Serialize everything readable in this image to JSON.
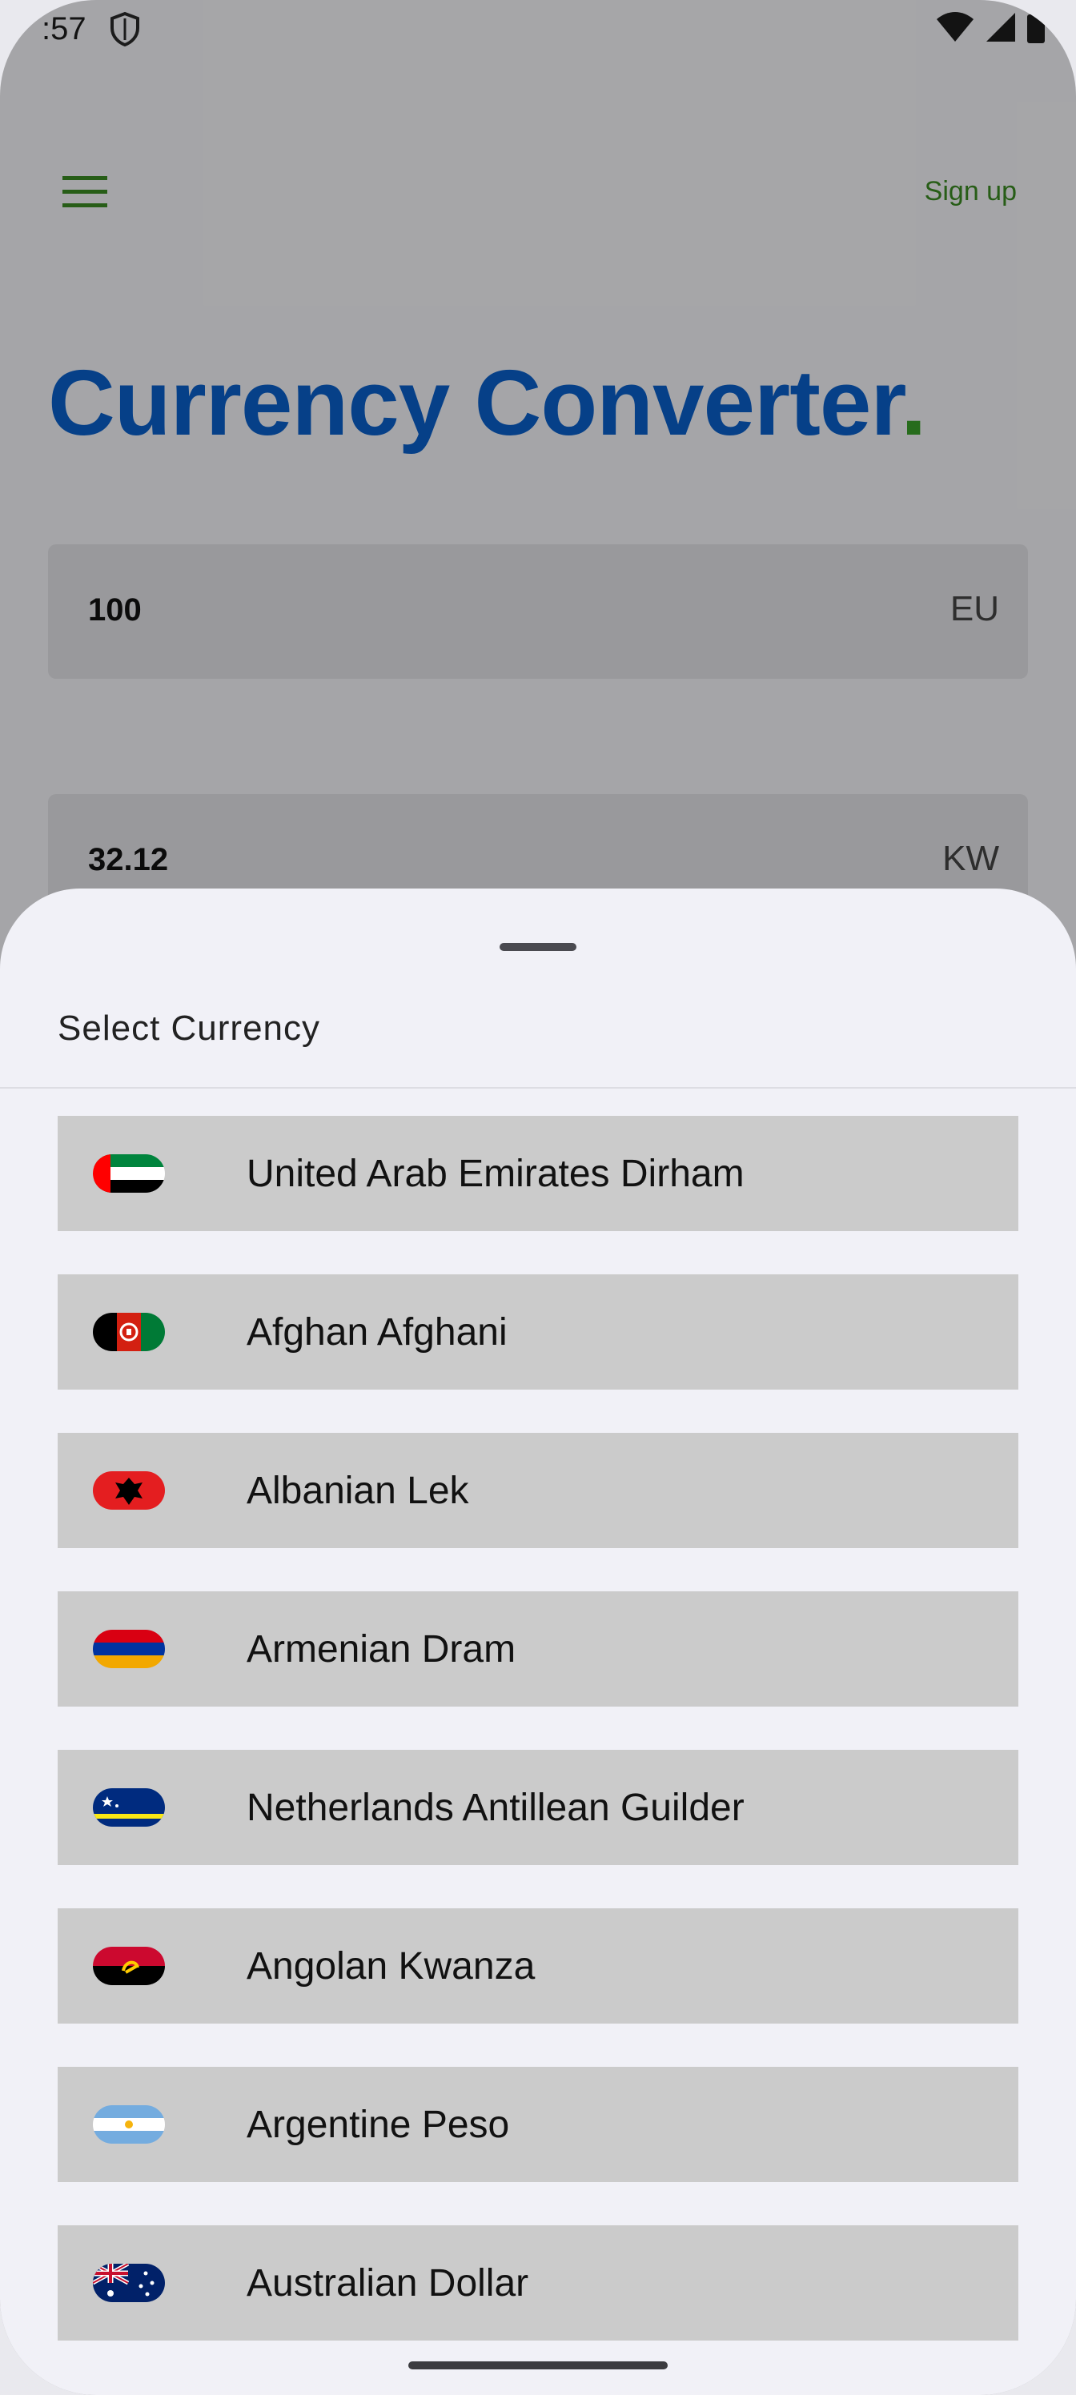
{
  "status_bar": {
    "time": ":57",
    "icons": [
      "shield-icon",
      "wifi-icon",
      "signal-icon",
      "battery-icon"
    ]
  },
  "header": {
    "menu_icon": "hamburger-menu-icon",
    "signup_label": "Sign up"
  },
  "page": {
    "title": "Currency Converter",
    "title_dot": "."
  },
  "converter": {
    "from": {
      "amount": "100",
      "currency": "EU"
    },
    "to": {
      "amount": "32.12",
      "currency": "KW"
    }
  },
  "sheet": {
    "title": "Select Currency",
    "currencies": [
      {
        "name": "United Arab Emirates Dirham",
        "flag": "ae-flag-icon"
      },
      {
        "name": "Afghan Afghani",
        "flag": "af-flag-icon"
      },
      {
        "name": "Albanian Lek",
        "flag": "al-flag-icon"
      },
      {
        "name": "Armenian Dram",
        "flag": "am-flag-icon"
      },
      {
        "name": "Netherlands Antillean Guilder",
        "flag": "an-flag-icon"
      },
      {
        "name": "Angolan Kwanza",
        "flag": "ao-flag-icon"
      },
      {
        "name": "Argentine Peso",
        "flag": "ar-flag-icon"
      },
      {
        "name": "Australian Dollar",
        "flag": "au-flag-icon"
      }
    ]
  },
  "colors": {
    "title": "#0a5fc9",
    "accent_green": "#3aa02a",
    "signup": "#3a8a22",
    "list_item_bg": "#cbcbcb",
    "sheet_bg": "#f1f1f7"
  }
}
